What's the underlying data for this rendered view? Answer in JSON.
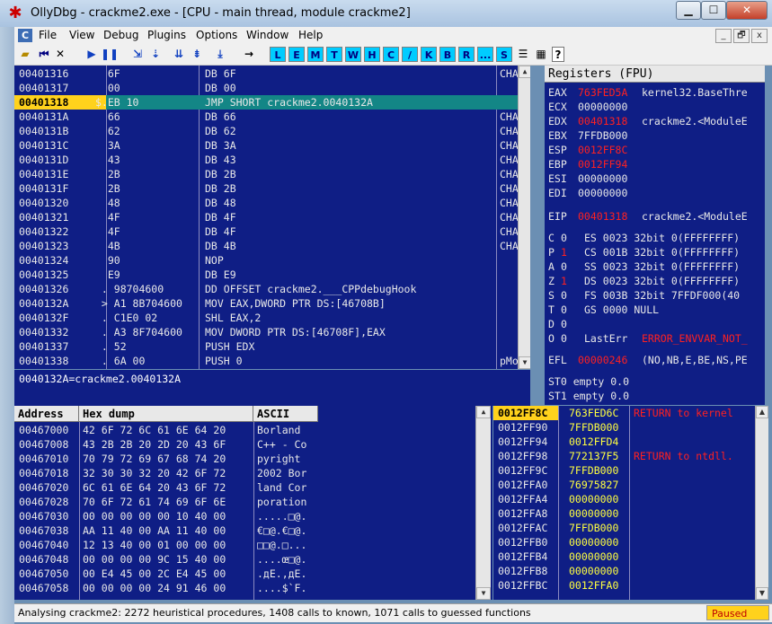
{
  "window": {
    "title": "OllyDbg - crackme2.exe - [CPU - main thread, module crackme2]",
    "min_glyph": "▁",
    "max_glyph": "☐",
    "close_glyph": "✕"
  },
  "menu": {
    "c_label": "C",
    "items": [
      "File",
      "View",
      "Debug",
      "Plugins",
      "Options",
      "Window",
      "Help"
    ],
    "mdi": [
      "_",
      "🗗",
      "x"
    ]
  },
  "toolbar": {
    "letters": [
      "L",
      "E",
      "M",
      "T",
      "W",
      "H",
      "C",
      "/",
      "K",
      "B",
      "R",
      "...",
      "S"
    ],
    "help": "?"
  },
  "disasm": {
    "rows": [
      {
        "addr": "00401316",
        "hex": "  6F",
        "asm": "DB 6F",
        "cmt": "CHAR"
      },
      {
        "addr": "00401317",
        "hex": "  00",
        "asm": "DB 00",
        "cmt": ""
      },
      {
        "addr": "00401318",
        "hex": "$.EB 10",
        "asm": "JMP SHORT crackme2.0040132A",
        "cmt": ""
      },
      {
        "addr": "0040131A",
        "hex": "  66",
        "asm": "DB 66",
        "cmt": "CHAR"
      },
      {
        "addr": "0040131B",
        "hex": "  62",
        "asm": "DB 62",
        "cmt": "CHAR"
      },
      {
        "addr": "0040131C",
        "hex": "  3A",
        "asm": "DB 3A",
        "cmt": "CHAR"
      },
      {
        "addr": "0040131D",
        "hex": "  43",
        "asm": "DB 43",
        "cmt": "CHAR"
      },
      {
        "addr": "0040131E",
        "hex": "  2B",
        "asm": "DB 2B",
        "cmt": "CHAR"
      },
      {
        "addr": "0040131F",
        "hex": "  2B",
        "asm": "DB 2B",
        "cmt": "CHAR"
      },
      {
        "addr": "00401320",
        "hex": "  48",
        "asm": "DB 48",
        "cmt": "CHAR"
      },
      {
        "addr": "00401321",
        "hex": "  4F",
        "asm": "DB 4F",
        "cmt": "CHAR"
      },
      {
        "addr": "00401322",
        "hex": "  4F",
        "asm": "DB 4F",
        "cmt": "CHAR"
      },
      {
        "addr": "00401323",
        "hex": "  4B",
        "asm": "DB 4B",
        "cmt": "CHAR"
      },
      {
        "addr": "00401324",
        "hex": "  90",
        "asm": "NOP",
        "cmt": ""
      },
      {
        "addr": "00401325",
        "hex": "  E9",
        "asm": "DB E9",
        "cmt": ""
      },
      {
        "addr": "00401326",
        "hex": " . 98704600",
        "asm": "DD OFFSET crackme2.___CPPdebugHook",
        "cmt": ""
      },
      {
        "addr": "0040132A",
        "hex": " > A1 8B704600",
        "asm": "MOV EAX,DWORD PTR DS:[46708B]",
        "cmt": ""
      },
      {
        "addr": "0040132F",
        "hex": " . C1E0 02",
        "asm": "SHL EAX,2",
        "cmt": ""
      },
      {
        "addr": "00401332",
        "hex": " . A3 8F704600",
        "asm": "MOV DWORD PTR DS:[46708F],EAX",
        "cmt": ""
      },
      {
        "addr": "00401337",
        "hex": " . 52",
        "asm": "PUSH EDX",
        "cmt": ""
      },
      {
        "addr": "00401338",
        "hex": " . 6A 00",
        "asm": "PUSH 0",
        "cmt": "pMod"
      }
    ],
    "selected_index": 2
  },
  "info": {
    "text": "0040132A=crackme2.0040132A"
  },
  "registers": {
    "header": "Registers (FPU)",
    "rows": [
      {
        "name": "EAX",
        "val": "763FED5A",
        "extra": "kernel32.BaseThre",
        "red": true
      },
      {
        "name": "ECX",
        "val": "00000000",
        "extra": "",
        "red": false
      },
      {
        "name": "EDX",
        "val": "00401318",
        "extra": "crackme2.<ModuleE",
        "red": true
      },
      {
        "name": "EBX",
        "val": "7FFDB000",
        "extra": "",
        "red": false
      },
      {
        "name": "ESP",
        "val": "0012FF8C",
        "extra": "",
        "red": true
      },
      {
        "name": "EBP",
        "val": "0012FF94",
        "extra": "",
        "red": true
      },
      {
        "name": "ESI",
        "val": "00000000",
        "extra": "",
        "red": false
      },
      {
        "name": "EDI",
        "val": "00000000",
        "extra": "",
        "red": false
      }
    ],
    "eip": {
      "name": "EIP",
      "val": "00401318",
      "extra": "crackme2.<ModuleE"
    },
    "flags": [
      {
        "f": "C",
        "v": "0",
        "seg": "ES 0023 32bit 0(FFFFFFFF)",
        "red": false
      },
      {
        "f": "P",
        "v": "1",
        "seg": "CS 001B 32bit 0(FFFFFFFF)",
        "red": true
      },
      {
        "f": "A",
        "v": "0",
        "seg": "SS 0023 32bit 0(FFFFFFFF)",
        "red": false
      },
      {
        "f": "Z",
        "v": "1",
        "seg": "DS 0023 32bit 0(FFFFFFFF)",
        "red": true
      },
      {
        "f": "S",
        "v": "0",
        "seg": "FS 003B 32bit 7FFDF000(40",
        "red": false
      },
      {
        "f": "T",
        "v": "0",
        "seg": "GS 0000 NULL",
        "red": false
      },
      {
        "f": "D",
        "v": "0",
        "seg": "",
        "red": false
      },
      {
        "f": "O",
        "v": "0",
        "seg": "LastErr",
        "red": false
      }
    ],
    "lasterr_val": "ERROR_ENVVAR_NOT_",
    "efl": {
      "name": "EFL",
      "val": "00000246",
      "extra": "(NO,NB,E,BE,NS,PE"
    },
    "fpu": [
      "ST0 empty 0.0",
      "ST1 empty 0.0"
    ]
  },
  "dump": {
    "headers": [
      "Address",
      "Hex dump",
      "ASCII"
    ],
    "rows": [
      {
        "addr": "00467000",
        "hex": "42 6F 72 6C 61 6E 64 20",
        "ascii": "Borland"
      },
      {
        "addr": "00467008",
        "hex": "43 2B 2B 20 2D 20 43 6F",
        "ascii": "C++ - Co"
      },
      {
        "addr": "00467010",
        "hex": "70 79 72 69 67 68 74 20",
        "ascii": "pyright"
      },
      {
        "addr": "00467018",
        "hex": "32 30 30 32 20 42 6F 72",
        "ascii": "2002 Bor"
      },
      {
        "addr": "00467020",
        "hex": "6C 61 6E 64 20 43 6F 72",
        "ascii": "land Cor"
      },
      {
        "addr": "00467028",
        "hex": "70 6F 72 61 74 69 6F 6E",
        "ascii": "poration"
      },
      {
        "addr": "00467030",
        "hex": "00 00 00 00 00 10 40 00",
        "ascii": ".....□@."
      },
      {
        "addr": "00467038",
        "hex": "AA 11 40 00 AA 11 40 00",
        "ascii": "€□@.€□@."
      },
      {
        "addr": "00467040",
        "hex": "12 13 40 00 01 00 00 00",
        "ascii": "□□@.□..."
      },
      {
        "addr": "00467048",
        "hex": "00 00 00 00 9C 15 40 00",
        "ascii": "....œ□@."
      },
      {
        "addr": "00467050",
        "hex": "00 E4 45 00 2C E4 45 00",
        "ascii": ".дE.,дE."
      },
      {
        "addr": "00467058",
        "hex": "00 00 00 00 24 91 46 00",
        "ascii": "....$`F."
      }
    ]
  },
  "stack": {
    "rows": [
      {
        "addr": "0012FF8C",
        "val": "763FED6C",
        "cmt": "RETURN to kernel"
      },
      {
        "addr": "0012FF90",
        "val": "7FFDB000",
        "cmt": ""
      },
      {
        "addr": "0012FF94",
        "val": "0012FFD4",
        "cmt": ""
      },
      {
        "addr": "0012FF98",
        "val": "772137F5",
        "cmt": "RETURN to ntdll."
      },
      {
        "addr": "0012FF9C",
        "val": "7FFDB000",
        "cmt": ""
      },
      {
        "addr": "0012FFA0",
        "val": "76975827",
        "cmt": ""
      },
      {
        "addr": "0012FFA4",
        "val": "00000000",
        "cmt": ""
      },
      {
        "addr": "0012FFA8",
        "val": "00000000",
        "cmt": ""
      },
      {
        "addr": "0012FFAC",
        "val": "7FFDB000",
        "cmt": ""
      },
      {
        "addr": "0012FFB0",
        "val": "00000000",
        "cmt": ""
      },
      {
        "addr": "0012FFB4",
        "val": "00000000",
        "cmt": ""
      },
      {
        "addr": "0012FFB8",
        "val": "00000000",
        "cmt": ""
      },
      {
        "addr": "0012FFBC",
        "val": "0012FFA0",
        "cmt": ""
      }
    ]
  },
  "status": {
    "text": "Analysing crackme2: 2272 heuristical procedures, 1408 calls to known, 1071 calls to guessed functions",
    "state": "Paused"
  },
  "colors": {
    "pane_bg": "#0f1e85",
    "selection": "#138686",
    "highlight": "#ffd21c",
    "error": "#ff2020"
  }
}
